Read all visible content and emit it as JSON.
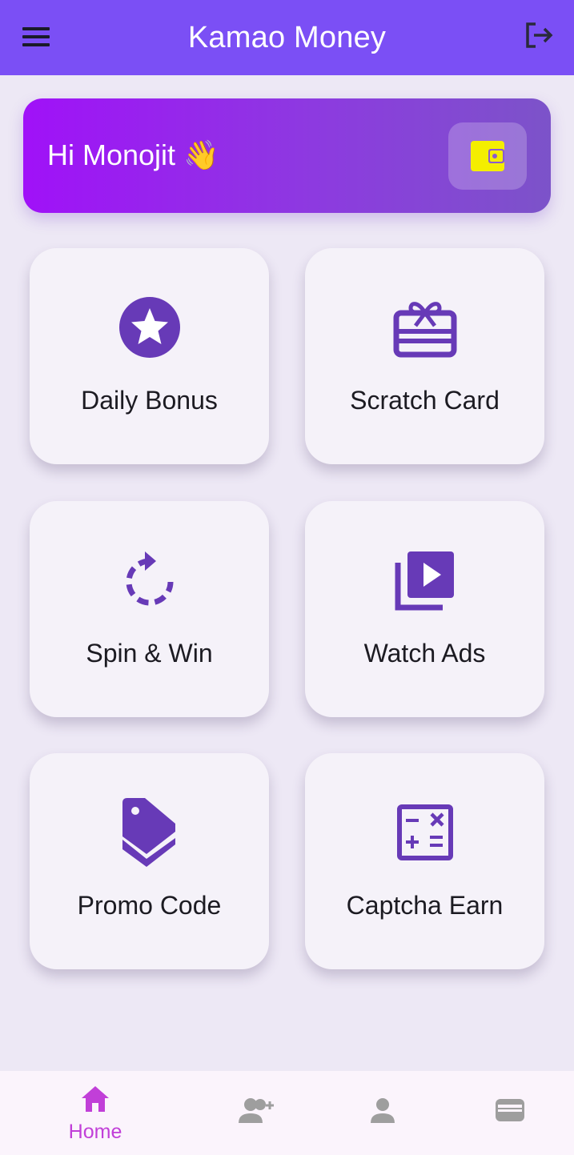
{
  "app": {
    "title": "Kamao Money"
  },
  "header": {
    "menu_icon": "menu-icon",
    "logout_icon": "logout-icon",
    "bar_color": "#7b4ff5"
  },
  "greeting": {
    "text": "Hi Monojit 👋",
    "wallet_icon": "wallet-icon",
    "wallet_icon_color": "#f4ee00"
  },
  "tiles": [
    {
      "label": "Daily Bonus",
      "icon": "star-circle-icon"
    },
    {
      "label": "Scratch Card",
      "icon": "gift-card-icon"
    },
    {
      "label": "Spin & Win",
      "icon": "rotate-icon"
    },
    {
      "label": "Watch Ads",
      "icon": "video-library-icon"
    },
    {
      "label": "Promo Code",
      "icon": "tags-icon"
    },
    {
      "label": "Captcha Earn",
      "icon": "calculator-icon"
    }
  ],
  "accent_color": "#673ab7",
  "bottom_nav": {
    "active_color": "#c13fd8",
    "inactive_color": "#9e9e9e",
    "items": [
      {
        "label": "Home",
        "icon": "home-icon",
        "active": true
      },
      {
        "label": "",
        "icon": "add-user-icon",
        "active": false
      },
      {
        "label": "",
        "icon": "profile-icon",
        "active": false
      },
      {
        "label": "",
        "icon": "wallet-icon",
        "active": false
      }
    ]
  }
}
